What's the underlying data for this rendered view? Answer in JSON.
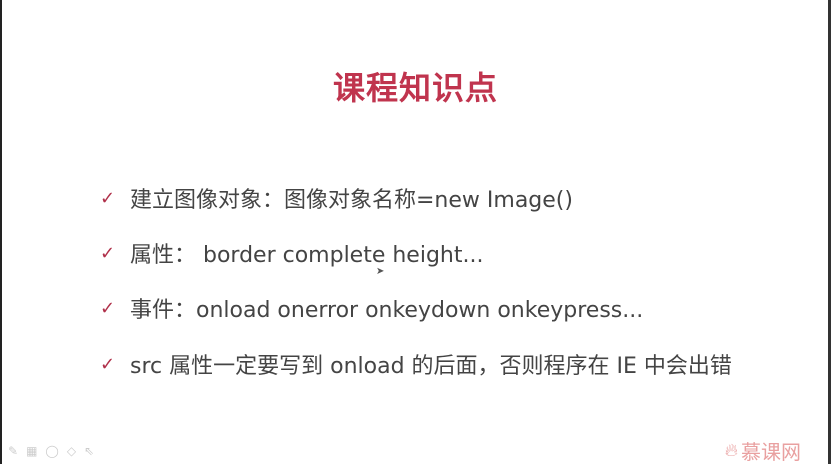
{
  "title": "课程知识点",
  "items": [
    "建立图像对象：图像对象名称=new Image()",
    "属性： border complete height...",
    "事件：onload onerror onkeydown onkeypress...",
    "src 属性一定要写到 onload 的后面，否则程序在 IE 中会出错"
  ],
  "logo": "慕课网",
  "colors": {
    "accent": "#c0344e",
    "text": "#444444"
  }
}
